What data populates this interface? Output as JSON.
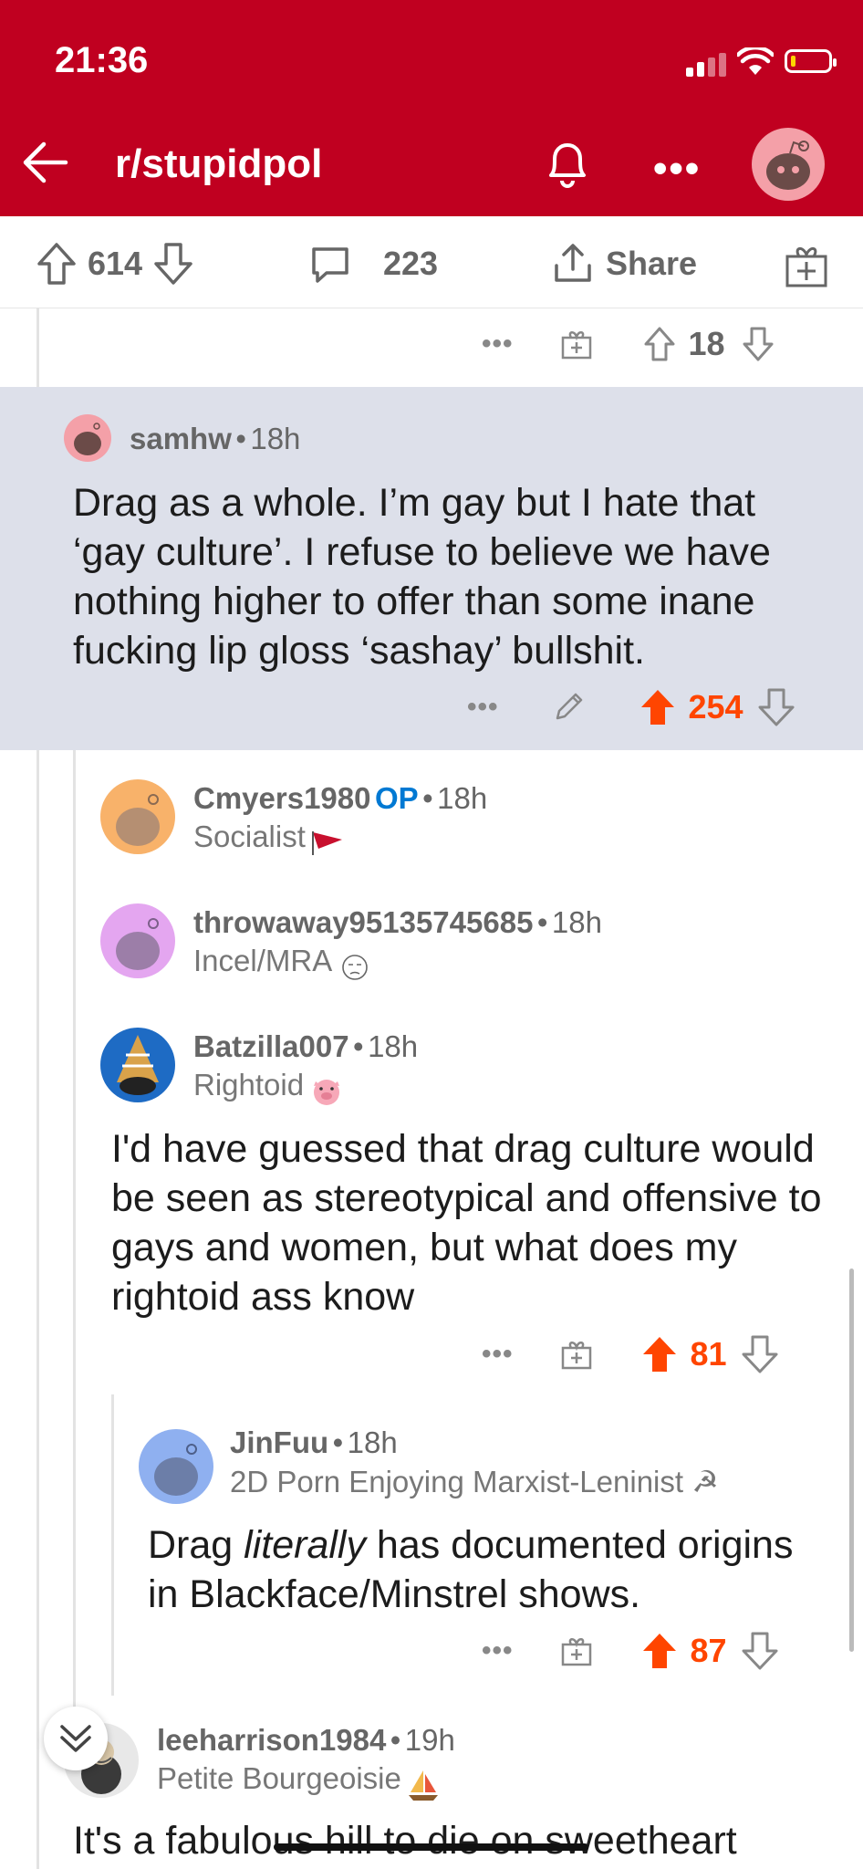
{
  "status": {
    "time": "21:36"
  },
  "header": {
    "title": "r/stupidpol"
  },
  "actionbar": {
    "upvotes": "614",
    "comments": "223",
    "share": "Share"
  },
  "prev_comment": {
    "score": "18"
  },
  "comments": [
    {
      "user": "samhw",
      "age": "18h",
      "body": "Drag as a whole. I’m gay but I hate that ‘gay culture’. I refuse to believe we have nothing higher to offer than some inane fucking lip gloss ‘sashay’ bullshit.",
      "score": "254"
    },
    {
      "user": "Cmyers1980",
      "op": "OP",
      "age": "18h",
      "flair": "Socialist"
    },
    {
      "user": "throwaway95135745685",
      "age": "18h",
      "flair": "Incel/MRA"
    },
    {
      "user": "Batzilla007",
      "age": "18h",
      "flair": "Rightoid",
      "body": "I'd have guessed that drag culture would be seen as stereotypical and offensive to gays and women, but what does my rightoid ass know",
      "score": "81"
    },
    {
      "user": "JinFuu",
      "age": "18h",
      "flair": "2D Porn Enjoying Marxist-Leninist ☭",
      "body_pre": "Drag ",
      "body_em": "literally",
      "body_post": " has documented origins in Blackface/Minstrel shows.",
      "score": "87"
    },
    {
      "user": "leeharrison1984",
      "age": "19h",
      "flair": "Petite Bourgeoisie",
      "body": "It's a fabulous hill to die on sweetheart"
    }
  ],
  "separator": "•",
  "more": "•••",
  "colors": {
    "header": "#c00020",
    "upvote": "#ff4500",
    "op": "#0079d3"
  }
}
